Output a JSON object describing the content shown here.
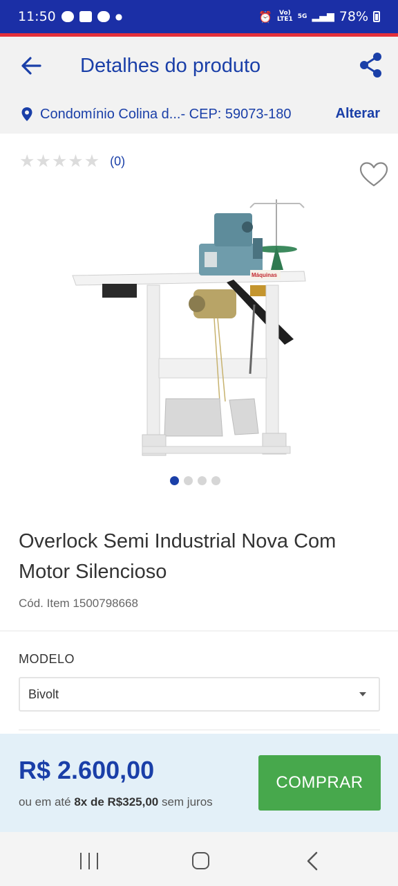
{
  "status_bar": {
    "time": "11:50",
    "battery": "78%",
    "network": "5G"
  },
  "header": {
    "title": "Detalhes do produto",
    "back_icon": "arrow-left-icon",
    "share_icon": "share-icon"
  },
  "location": {
    "icon": "map-pin-icon",
    "text": "Condomínio Colina d...- CEP: 59073-180",
    "change_label": "Alterar"
  },
  "product": {
    "rating_stars": 0,
    "rating_max": 5,
    "rating_count": "(0)",
    "favorite_icon": "heart-icon",
    "image_slides": 4,
    "active_slide": 1,
    "title": "Overlock Semi Industrial Nova Com Motor Silencioso",
    "code": "Cód. Item 1500798668",
    "model_label": "MODELO",
    "model_selected": "Bivolt"
  },
  "buy_bar": {
    "price": "R$ 2.600,00",
    "installments_prefix": "ou em até ",
    "installments_bold": "8x de R$325,00",
    "installments_suffix": " sem juros",
    "buy_label": "COMPRAR"
  },
  "colors": {
    "brand_blue": "#1a3fa8",
    "buy_green": "#47a84c",
    "status_bar": "#1b2fa6"
  }
}
